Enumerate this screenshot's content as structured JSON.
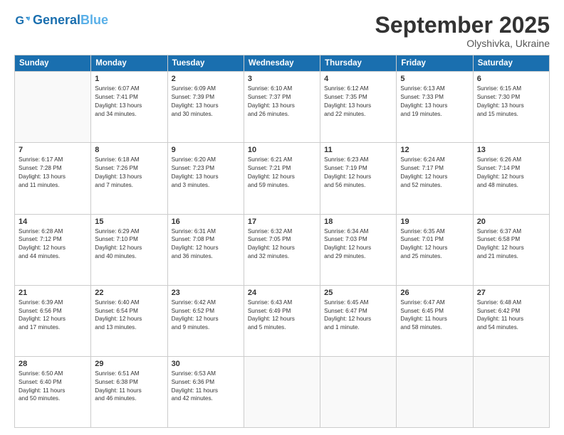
{
  "header": {
    "logo_general": "General",
    "logo_blue": "Blue",
    "month": "September 2025",
    "location": "Olyshivka, Ukraine"
  },
  "days_of_week": [
    "Sunday",
    "Monday",
    "Tuesday",
    "Wednesday",
    "Thursday",
    "Friday",
    "Saturday"
  ],
  "weeks": [
    [
      {
        "day": "",
        "info": ""
      },
      {
        "day": "1",
        "info": "Sunrise: 6:07 AM\nSunset: 7:41 PM\nDaylight: 13 hours\nand 34 minutes."
      },
      {
        "day": "2",
        "info": "Sunrise: 6:09 AM\nSunset: 7:39 PM\nDaylight: 13 hours\nand 30 minutes."
      },
      {
        "day": "3",
        "info": "Sunrise: 6:10 AM\nSunset: 7:37 PM\nDaylight: 13 hours\nand 26 minutes."
      },
      {
        "day": "4",
        "info": "Sunrise: 6:12 AM\nSunset: 7:35 PM\nDaylight: 13 hours\nand 22 minutes."
      },
      {
        "day": "5",
        "info": "Sunrise: 6:13 AM\nSunset: 7:33 PM\nDaylight: 13 hours\nand 19 minutes."
      },
      {
        "day": "6",
        "info": "Sunrise: 6:15 AM\nSunset: 7:30 PM\nDaylight: 13 hours\nand 15 minutes."
      }
    ],
    [
      {
        "day": "7",
        "info": "Sunrise: 6:17 AM\nSunset: 7:28 PM\nDaylight: 13 hours\nand 11 minutes."
      },
      {
        "day": "8",
        "info": "Sunrise: 6:18 AM\nSunset: 7:26 PM\nDaylight: 13 hours\nand 7 minutes."
      },
      {
        "day": "9",
        "info": "Sunrise: 6:20 AM\nSunset: 7:23 PM\nDaylight: 13 hours\nand 3 minutes."
      },
      {
        "day": "10",
        "info": "Sunrise: 6:21 AM\nSunset: 7:21 PM\nDaylight: 12 hours\nand 59 minutes."
      },
      {
        "day": "11",
        "info": "Sunrise: 6:23 AM\nSunset: 7:19 PM\nDaylight: 12 hours\nand 56 minutes."
      },
      {
        "day": "12",
        "info": "Sunrise: 6:24 AM\nSunset: 7:17 PM\nDaylight: 12 hours\nand 52 minutes."
      },
      {
        "day": "13",
        "info": "Sunrise: 6:26 AM\nSunset: 7:14 PM\nDaylight: 12 hours\nand 48 minutes."
      }
    ],
    [
      {
        "day": "14",
        "info": "Sunrise: 6:28 AM\nSunset: 7:12 PM\nDaylight: 12 hours\nand 44 minutes."
      },
      {
        "day": "15",
        "info": "Sunrise: 6:29 AM\nSunset: 7:10 PM\nDaylight: 12 hours\nand 40 minutes."
      },
      {
        "day": "16",
        "info": "Sunrise: 6:31 AM\nSunset: 7:08 PM\nDaylight: 12 hours\nand 36 minutes."
      },
      {
        "day": "17",
        "info": "Sunrise: 6:32 AM\nSunset: 7:05 PM\nDaylight: 12 hours\nand 32 minutes."
      },
      {
        "day": "18",
        "info": "Sunrise: 6:34 AM\nSunset: 7:03 PM\nDaylight: 12 hours\nand 29 minutes."
      },
      {
        "day": "19",
        "info": "Sunrise: 6:35 AM\nSunset: 7:01 PM\nDaylight: 12 hours\nand 25 minutes."
      },
      {
        "day": "20",
        "info": "Sunrise: 6:37 AM\nSunset: 6:58 PM\nDaylight: 12 hours\nand 21 minutes."
      }
    ],
    [
      {
        "day": "21",
        "info": "Sunrise: 6:39 AM\nSunset: 6:56 PM\nDaylight: 12 hours\nand 17 minutes."
      },
      {
        "day": "22",
        "info": "Sunrise: 6:40 AM\nSunset: 6:54 PM\nDaylight: 12 hours\nand 13 minutes."
      },
      {
        "day": "23",
        "info": "Sunrise: 6:42 AM\nSunset: 6:52 PM\nDaylight: 12 hours\nand 9 minutes."
      },
      {
        "day": "24",
        "info": "Sunrise: 6:43 AM\nSunset: 6:49 PM\nDaylight: 12 hours\nand 5 minutes."
      },
      {
        "day": "25",
        "info": "Sunrise: 6:45 AM\nSunset: 6:47 PM\nDaylight: 12 hours\nand 1 minute."
      },
      {
        "day": "26",
        "info": "Sunrise: 6:47 AM\nSunset: 6:45 PM\nDaylight: 11 hours\nand 58 minutes."
      },
      {
        "day": "27",
        "info": "Sunrise: 6:48 AM\nSunset: 6:42 PM\nDaylight: 11 hours\nand 54 minutes."
      }
    ],
    [
      {
        "day": "28",
        "info": "Sunrise: 6:50 AM\nSunset: 6:40 PM\nDaylight: 11 hours\nand 50 minutes."
      },
      {
        "day": "29",
        "info": "Sunrise: 6:51 AM\nSunset: 6:38 PM\nDaylight: 11 hours\nand 46 minutes."
      },
      {
        "day": "30",
        "info": "Sunrise: 6:53 AM\nSunset: 6:36 PM\nDaylight: 11 hours\nand 42 minutes."
      },
      {
        "day": "",
        "info": ""
      },
      {
        "day": "",
        "info": ""
      },
      {
        "day": "",
        "info": ""
      },
      {
        "day": "",
        "info": ""
      }
    ]
  ]
}
